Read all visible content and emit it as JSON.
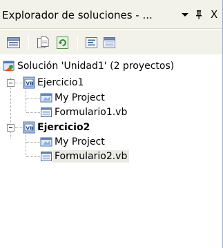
{
  "panel": {
    "title": "Explorador de soluciones - ...",
    "dropdown_icon": "chevron-down-icon",
    "pin_label": "ᵠ",
    "close_label": "X"
  },
  "toolbar": {
    "buttons": [
      {
        "name": "properties-button",
        "icon": "properties-icon"
      },
      {
        "name": "show-all-files-button",
        "icon": "show-all-files-icon"
      },
      {
        "name": "refresh-button",
        "icon": "refresh-icon"
      },
      {
        "name": "view-code-button",
        "icon": "view-code-icon"
      },
      {
        "name": "view-designer-button",
        "icon": "view-designer-icon"
      }
    ]
  },
  "tree": {
    "solution": {
      "label": "Solución 'Unidad1' (2 proyectos)",
      "icon": "solution-icon"
    },
    "projects": [
      {
        "label": "Ejercicio1",
        "bold": false,
        "expanded": true,
        "icon": "vb-project-icon",
        "children": [
          {
            "label": "My Project",
            "icon": "my-project-icon"
          },
          {
            "label": "Formulario1.vb",
            "icon": "form-icon"
          }
        ]
      },
      {
        "label": "Ejercicio2",
        "bold": true,
        "expanded": true,
        "icon": "vb-project-icon",
        "children": [
          {
            "label": "My Project",
            "icon": "my-project-icon"
          },
          {
            "label": "Formulario2.vb",
            "icon": "form-icon",
            "selected": true
          }
        ]
      }
    ]
  }
}
